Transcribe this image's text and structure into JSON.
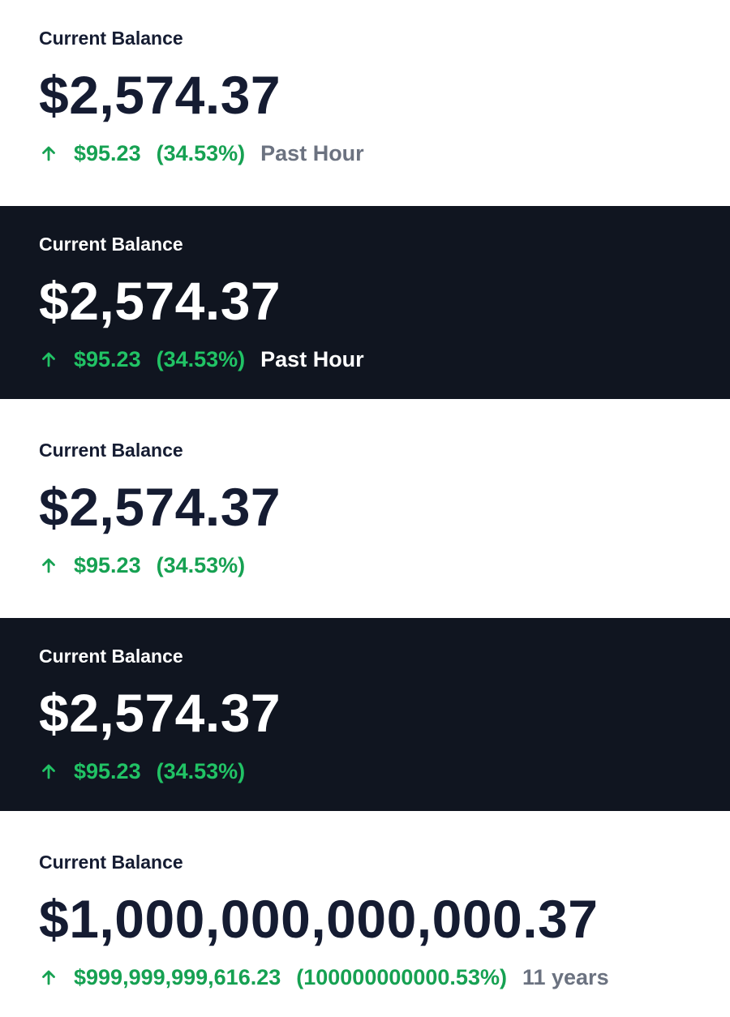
{
  "colors": {
    "dark_background": "#101520",
    "light_background": "#ffffff",
    "text_dark": "#151c32",
    "positive_green_light": "#16a152",
    "positive_green_dark": "#21c365",
    "muted_gray": "#6b7280"
  },
  "cards": [
    {
      "theme": "light",
      "label": "Current Balance",
      "balance": "$2,574.37",
      "change_icon": "arrow-up-icon",
      "change_amount": "$95.23",
      "change_percent": "(34.53%)",
      "period": "Past Hour"
    },
    {
      "theme": "dark",
      "label": "Current Balance",
      "balance": "$2,574.37",
      "change_icon": "arrow-up-icon",
      "change_amount": "$95.23",
      "change_percent": "(34.53%)",
      "period": "Past Hour"
    },
    {
      "theme": "light",
      "label": "Current Balance",
      "balance": "$2,574.37",
      "change_icon": "arrow-up-icon",
      "change_amount": "$95.23",
      "change_percent": "(34.53%)"
    },
    {
      "theme": "dark",
      "label": "Current Balance",
      "balance": "$2,574.37",
      "change_icon": "arrow-up-icon",
      "change_amount": "$95.23",
      "change_percent": "(34.53%)"
    },
    {
      "theme": "light",
      "label": "Current Balance",
      "balance": "$1,000,000,000,000.37",
      "change_icon": "arrow-up-icon",
      "change_amount": "$999,999,999,616.23",
      "change_percent": "(100000000000.53%)",
      "period": "11 years"
    }
  ]
}
